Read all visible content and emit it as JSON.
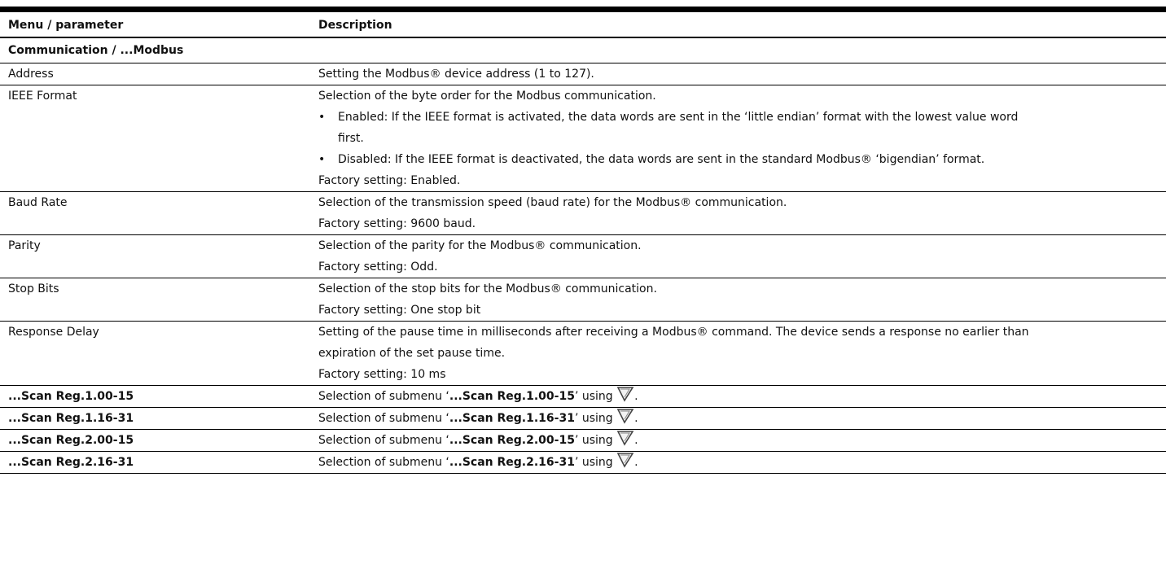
{
  "table": {
    "headers": {
      "parameter": "Menu / parameter",
      "description": "Description"
    },
    "section": "Communication / ...Modbus",
    "address": {
      "name": "Address",
      "desc": "Setting the Modbus® device address (1 to 127)."
    },
    "ieee": {
      "name": "IEEE Format",
      "desc": "Selection of the byte order for the Modbus communication.",
      "bullet_marker": "•",
      "bullet1_l1": "Enabled: If the IEEE format is activated, the data words are sent in the ‘little endian’ format with the lowest value word",
      "bullet1_l2": "first.",
      "bullet2": "Disabled: If the IEEE format is deactivated, the data words are sent in the standard Modbus® ‘bigendian’ format.",
      "factory": "Factory setting: Enabled."
    },
    "baud": {
      "name": "Baud Rate",
      "desc": "Selection of the transmission speed (baud rate) for the Modbus® communication.",
      "factory": "Factory setting: 9600 baud."
    },
    "parity": {
      "name": "Parity",
      "desc": "Selection of the parity for the Modbus® communication.",
      "factory": "Factory setting: Odd."
    },
    "stopbits": {
      "name": "Stop Bits",
      "desc": "Selection of the stop bits for the Modbus® communication.",
      "factory": "Factory setting: One stop bit"
    },
    "delay": {
      "name": "Response Delay",
      "desc_l1": "Setting of the pause time in milliseconds after receiving a Modbus® command. The device sends a response no earlier than",
      "desc_l2": "expiration of the set pause time.",
      "factory": "Factory setting: 10 ms"
    },
    "submenu_prefix": "Selection of submenu ‘",
    "submenu_suffix": "’ using",
    "submenu_end": ".",
    "submenu_icon": "navigate-right-key-icon",
    "scan_rows": [
      {
        "name": "...Scan Reg.1.00-15"
      },
      {
        "name": "...Scan Reg.1.16-31"
      },
      {
        "name": "...Scan Reg.2.00-15"
      },
      {
        "name": "...Scan Reg.2.16-31"
      }
    ]
  }
}
